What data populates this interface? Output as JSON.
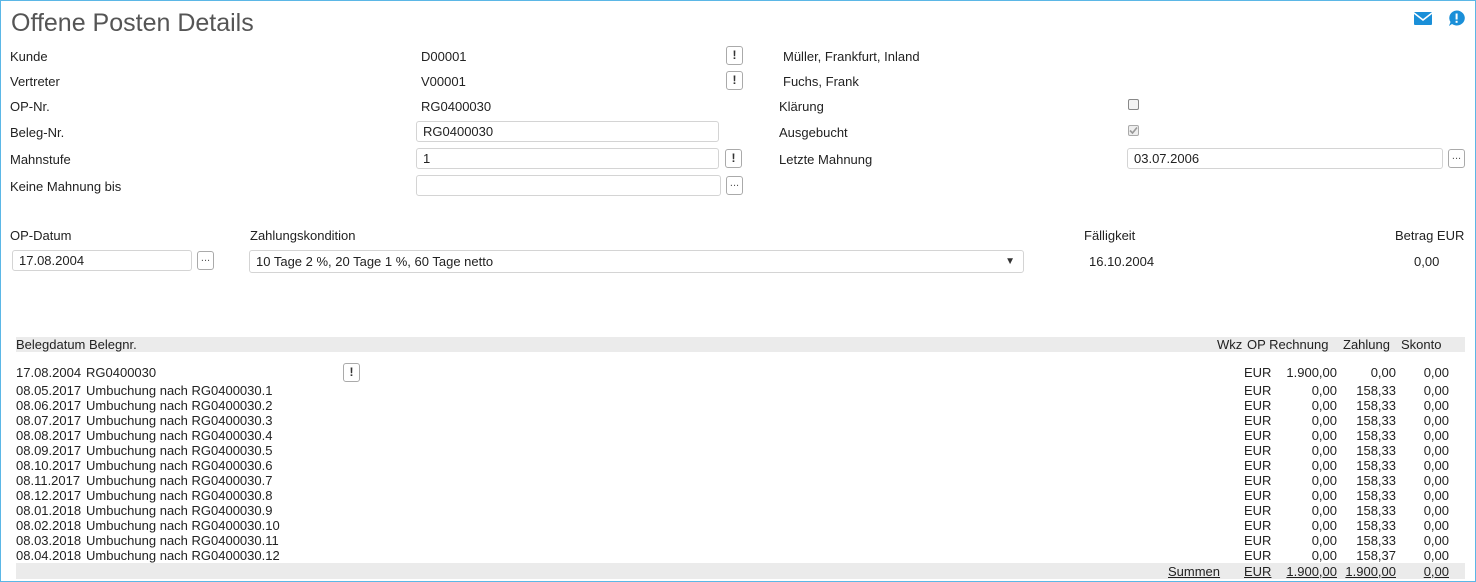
{
  "header": {
    "title": "Offene Posten Details",
    "mail_icon": "envelope-icon",
    "help_icon": "info-bubble-icon"
  },
  "form": {
    "kunde": {
      "label": "Kunde",
      "value": "D00001",
      "name": "Müller, Frankfurt, Inland"
    },
    "vertreter": {
      "label": "Vertreter",
      "value": "V00001",
      "name": "Fuchs, Frank"
    },
    "op_nr": {
      "label": "OP-Nr.",
      "value": "RG0400030"
    },
    "klaerung": {
      "label": "Klärung",
      "checked": false
    },
    "beleg_nr": {
      "label": "Beleg-Nr.",
      "value": "RG0400030"
    },
    "ausgebucht": {
      "label": "Ausgebucht",
      "checked": true
    },
    "mahnstufe": {
      "label": "Mahnstufe",
      "value": "1"
    },
    "letzte_mahnung": {
      "label": "Letzte Mahnung",
      "value": "03.07.2006"
    },
    "keine_mahnung_bis": {
      "label": "Keine Mahnung bis",
      "value": ""
    },
    "op_datum": {
      "label": "OP-Datum",
      "value": "17.08.2004"
    },
    "zahlungskondition": {
      "label": "Zahlungskondition",
      "value": "10 Tage 2 %, 20 Tage 1 %, 60 Tage netto"
    },
    "faelligkeit": {
      "label": "Fälligkeit",
      "value": "16.10.2004"
    },
    "betrag": {
      "label": "Betrag EUR",
      "value": "0,00"
    }
  },
  "buttons": {
    "alert": "!",
    "more": "..."
  },
  "table": {
    "headers": {
      "belegdatum_belegnr": "Belegdatum Belegnr.",
      "wkz": "Wkz",
      "op_rechnung": "OP Rechnung",
      "zahlung": "Zahlung",
      "skonto": "Skonto"
    },
    "first_row": {
      "date": "17.08.2004",
      "text": "RG0400030",
      "wkz": "EUR",
      "rechnung": "1.900,00",
      "zahlung": "0,00",
      "skonto": "0,00"
    },
    "rows": [
      {
        "date": "08.05.2017",
        "text": "Umbuchung nach RG0400030.1",
        "wkz": "EUR",
        "rechnung": "0,00",
        "zahlung": "158,33",
        "skonto": "0,00"
      },
      {
        "date": "08.06.2017",
        "text": "Umbuchung nach RG0400030.2",
        "wkz": "EUR",
        "rechnung": "0,00",
        "zahlung": "158,33",
        "skonto": "0,00"
      },
      {
        "date": "08.07.2017",
        "text": "Umbuchung nach RG0400030.3",
        "wkz": "EUR",
        "rechnung": "0,00",
        "zahlung": "158,33",
        "skonto": "0,00"
      },
      {
        "date": "08.08.2017",
        "text": "Umbuchung nach RG0400030.4",
        "wkz": "EUR",
        "rechnung": "0,00",
        "zahlung": "158,33",
        "skonto": "0,00"
      },
      {
        "date": "08.09.2017",
        "text": "Umbuchung nach RG0400030.5",
        "wkz": "EUR",
        "rechnung": "0,00",
        "zahlung": "158,33",
        "skonto": "0,00"
      },
      {
        "date": "08.10.2017",
        "text": "Umbuchung nach RG0400030.6",
        "wkz": "EUR",
        "rechnung": "0,00",
        "zahlung": "158,33",
        "skonto": "0,00"
      },
      {
        "date": "08.11.2017",
        "text": "Umbuchung nach RG0400030.7",
        "wkz": "EUR",
        "rechnung": "0,00",
        "zahlung": "158,33",
        "skonto": "0,00"
      },
      {
        "date": "08.12.2017",
        "text": "Umbuchung nach RG0400030.8",
        "wkz": "EUR",
        "rechnung": "0,00",
        "zahlung": "158,33",
        "skonto": "0,00"
      },
      {
        "date": "08.01.2018",
        "text": "Umbuchung nach RG0400030.9",
        "wkz": "EUR",
        "rechnung": "0,00",
        "zahlung": "158,33",
        "skonto": "0,00"
      },
      {
        "date": "08.02.2018",
        "text": "Umbuchung nach RG0400030.10",
        "wkz": "EUR",
        "rechnung": "0,00",
        "zahlung": "158,33",
        "skonto": "0,00"
      },
      {
        "date": "08.03.2018",
        "text": "Umbuchung nach RG0400030.11",
        "wkz": "EUR",
        "rechnung": "0,00",
        "zahlung": "158,33",
        "skonto": "0,00"
      },
      {
        "date": "08.04.2018",
        "text": "Umbuchung nach RG0400030.12",
        "wkz": "EUR",
        "rechnung": "0,00",
        "zahlung": "158,37",
        "skonto": "0,00"
      }
    ],
    "summen": {
      "label": "Summen",
      "wkz": "EUR",
      "rechnung": "1.900,00",
      "zahlung": "1.900,00",
      "skonto": "0,00"
    }
  },
  "colors": {
    "accent": "#1a8fd8",
    "border": "#5bb7e6",
    "header_bg": "#ebebeb"
  }
}
